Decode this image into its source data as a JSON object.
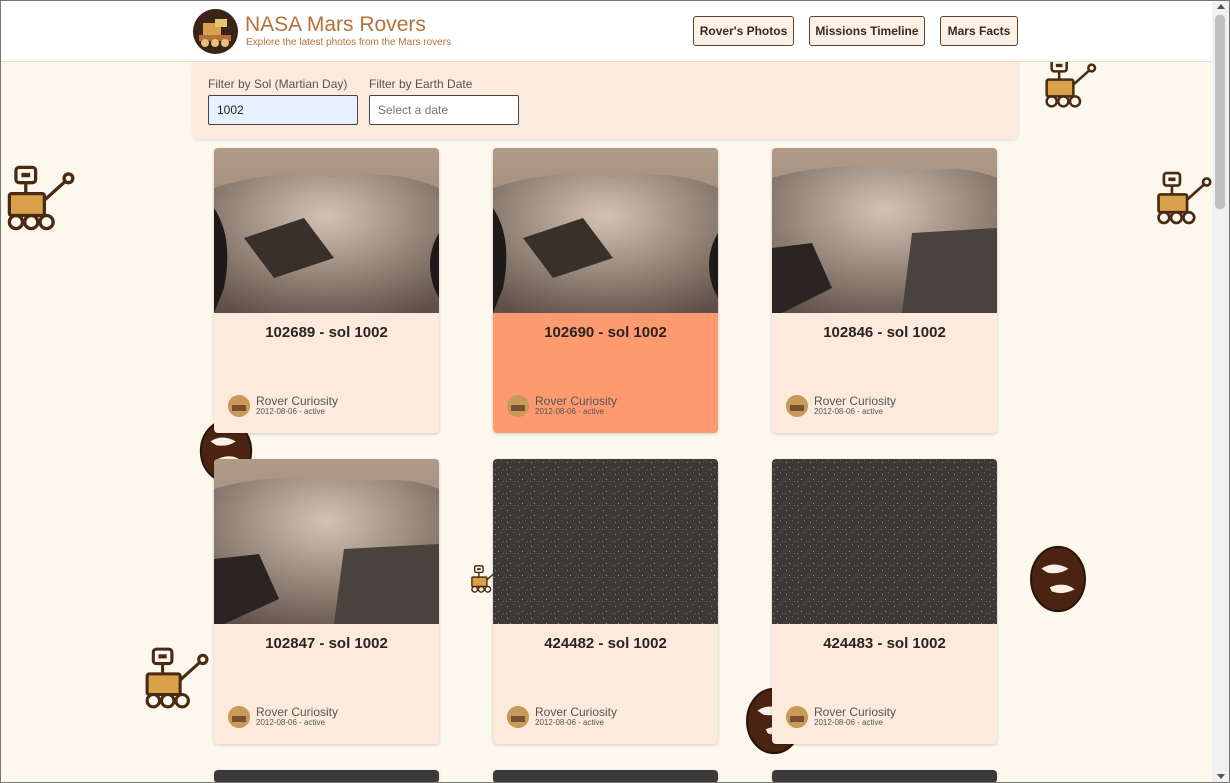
{
  "header": {
    "title": "NASA Mars Rovers",
    "subtitle": "Explore the latest photos from the Mars rovers",
    "nav": [
      "Rover's Photos",
      "Missions Timeline",
      "Mars Facts"
    ]
  },
  "filters": {
    "sol_label": "Filter by Sol (Martian Day)",
    "sol_value": "1002",
    "date_label": "Filter by Earth Date",
    "date_placeholder": "Select a date"
  },
  "photos": [
    {
      "title": "102689 - sol 1002",
      "rover": "Rover Curiosity",
      "meta": "2012-08-06 - active",
      "image": "terrain"
    },
    {
      "title": "102690 - sol 1002",
      "rover": "Rover Curiosity",
      "meta": "2012-08-06 - active",
      "image": "terrain"
    },
    {
      "title": "102846 - sol 1002",
      "rover": "Rover Curiosity",
      "meta": "2012-08-06 - active",
      "image": "terrain-wheel"
    },
    {
      "title": "102847 - sol 1002",
      "rover": "Rover Curiosity",
      "meta": "2012-08-06 - active",
      "image": "terrain-wheel"
    },
    {
      "title": "424482 - sol 1002",
      "rover": "Rover Curiosity",
      "meta": "2012-08-06 - active",
      "image": "noise"
    },
    {
      "title": "424483 - sol 1002",
      "rover": "Rover Curiosity",
      "meta": "2012-08-06 - active",
      "image": "noise"
    }
  ],
  "colors": {
    "accent": "#b5713a",
    "card": "#fcebdc",
    "card_selected": "#fd9a70",
    "background": "#fcf8ee"
  }
}
